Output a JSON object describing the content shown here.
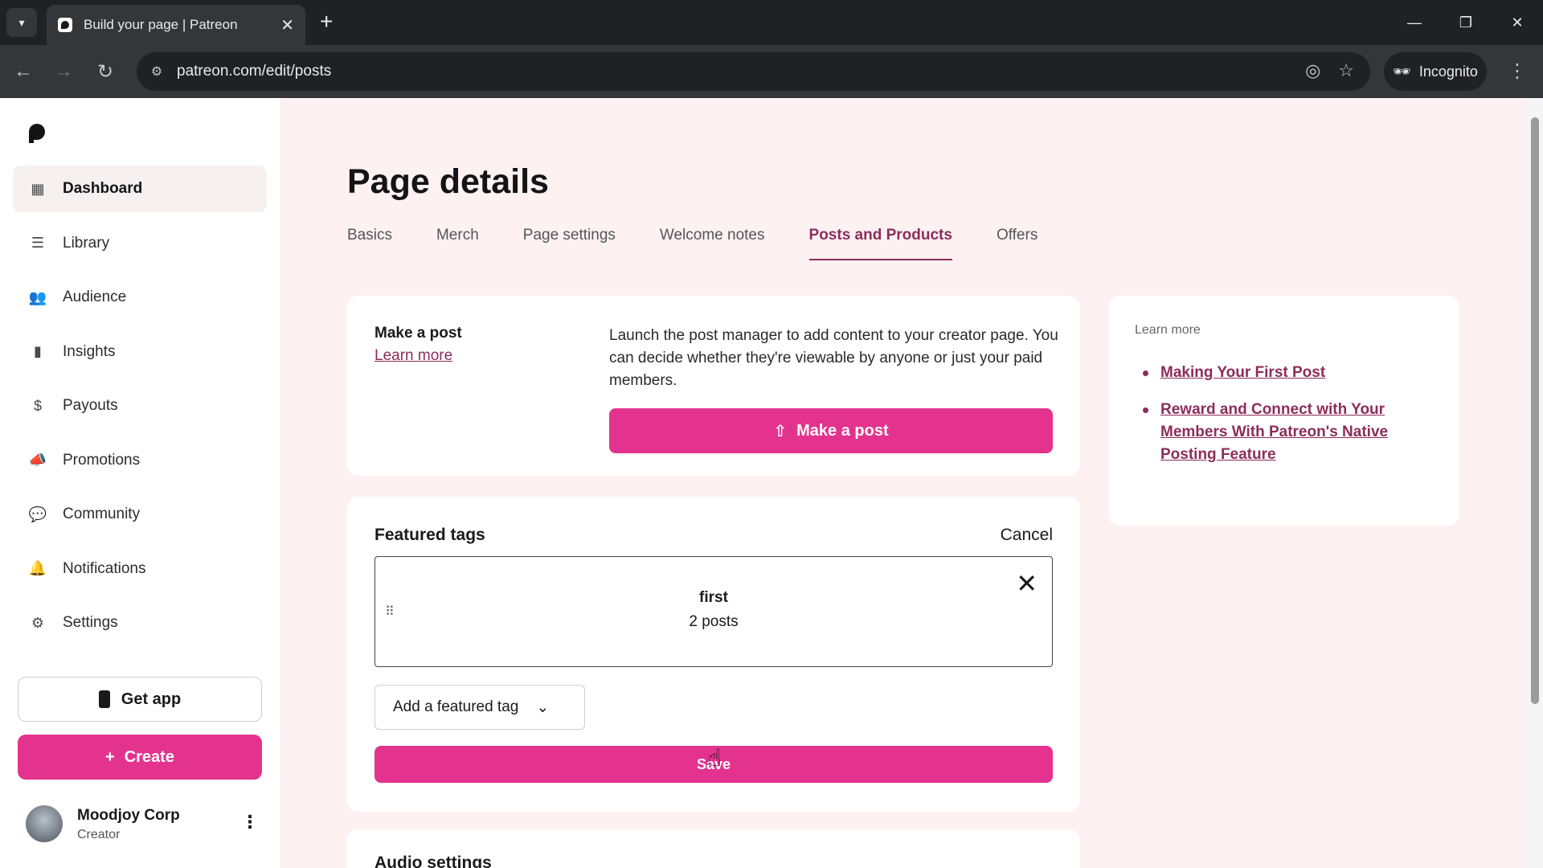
{
  "browser": {
    "tab_title": "Build your page | Patreon",
    "url": "patreon.com/edit/posts",
    "incognito_label": "Incognito"
  },
  "sidebar": {
    "items": [
      {
        "label": "Dashboard",
        "icon": "dashboard-icon"
      },
      {
        "label": "Library",
        "icon": "library-icon"
      },
      {
        "label": "Audience",
        "icon": "audience-icon"
      },
      {
        "label": "Insights",
        "icon": "insights-icon"
      },
      {
        "label": "Payouts",
        "icon": "payouts-icon"
      },
      {
        "label": "Promotions",
        "icon": "promotions-icon"
      },
      {
        "label": "Community",
        "icon": "community-icon"
      },
      {
        "label": "Notifications",
        "icon": "bell-icon"
      },
      {
        "label": "Settings",
        "icon": "gear-icon"
      }
    ],
    "get_app": "Get app",
    "create": "Create",
    "user": {
      "name": "Moodjoy Corp",
      "role": "Creator"
    }
  },
  "main": {
    "title": "Page details",
    "tabs": [
      "Basics",
      "Merch",
      "Page settings",
      "Welcome notes",
      "Posts and Products",
      "Offers"
    ],
    "make_post": {
      "title": "Make a post",
      "learn_more": "Learn more",
      "description": "Launch the post manager to add content to your creator page. You can decide whether they're viewable by anyone or just your paid members.",
      "button": "Make a post"
    },
    "featured_tags": {
      "title": "Featured tags",
      "cancel": "Cancel",
      "tag_name": "first",
      "tag_count": "2 posts",
      "select_label": "Add a featured tag",
      "save": "Save"
    },
    "audio_settings_title": "Audio settings"
  },
  "learn_more_card": {
    "heading": "Learn more",
    "links": [
      "Making Your First Post",
      "Reward and Connect with Your Members With Patreon's Native Posting Feature"
    ]
  },
  "colors": {
    "accent": "#e3338e",
    "link": "#8c2d5b",
    "background": "#fdf1f2"
  }
}
